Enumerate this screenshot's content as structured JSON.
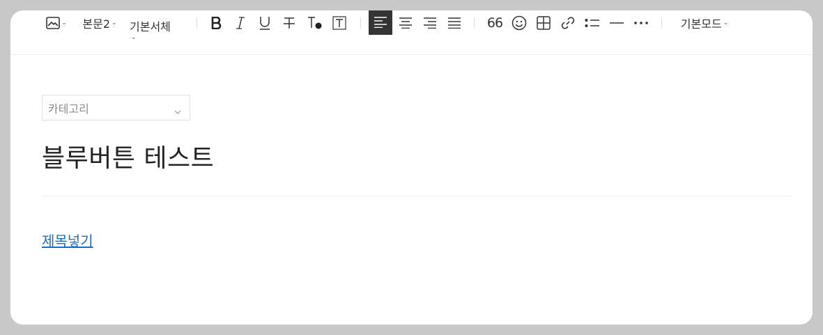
{
  "toolbar": {
    "image_icon": "image-icon",
    "paragraph_style": "본문2",
    "font_family": "기본서체",
    "quote_glyph": "66",
    "mode": "기본모드",
    "buttons": [
      "image",
      "paragraph-style",
      "font-family",
      "bold",
      "italic",
      "underline",
      "strikethrough",
      "text-color",
      "text-background",
      "align-left",
      "align-center",
      "align-right",
      "align-justify",
      "quote",
      "emoji",
      "table",
      "link",
      "list",
      "divider",
      "more",
      "mode"
    ],
    "active_align": "left"
  },
  "category": {
    "placeholder": "카테고리"
  },
  "post": {
    "title": "블루버튼 테스트",
    "body_link": "제목넣기"
  },
  "colors": {
    "page_bg": "#c8c8c8",
    "editor_bg": "#ffffff",
    "active_button": "#333333",
    "link": "#1a6ebd"
  }
}
